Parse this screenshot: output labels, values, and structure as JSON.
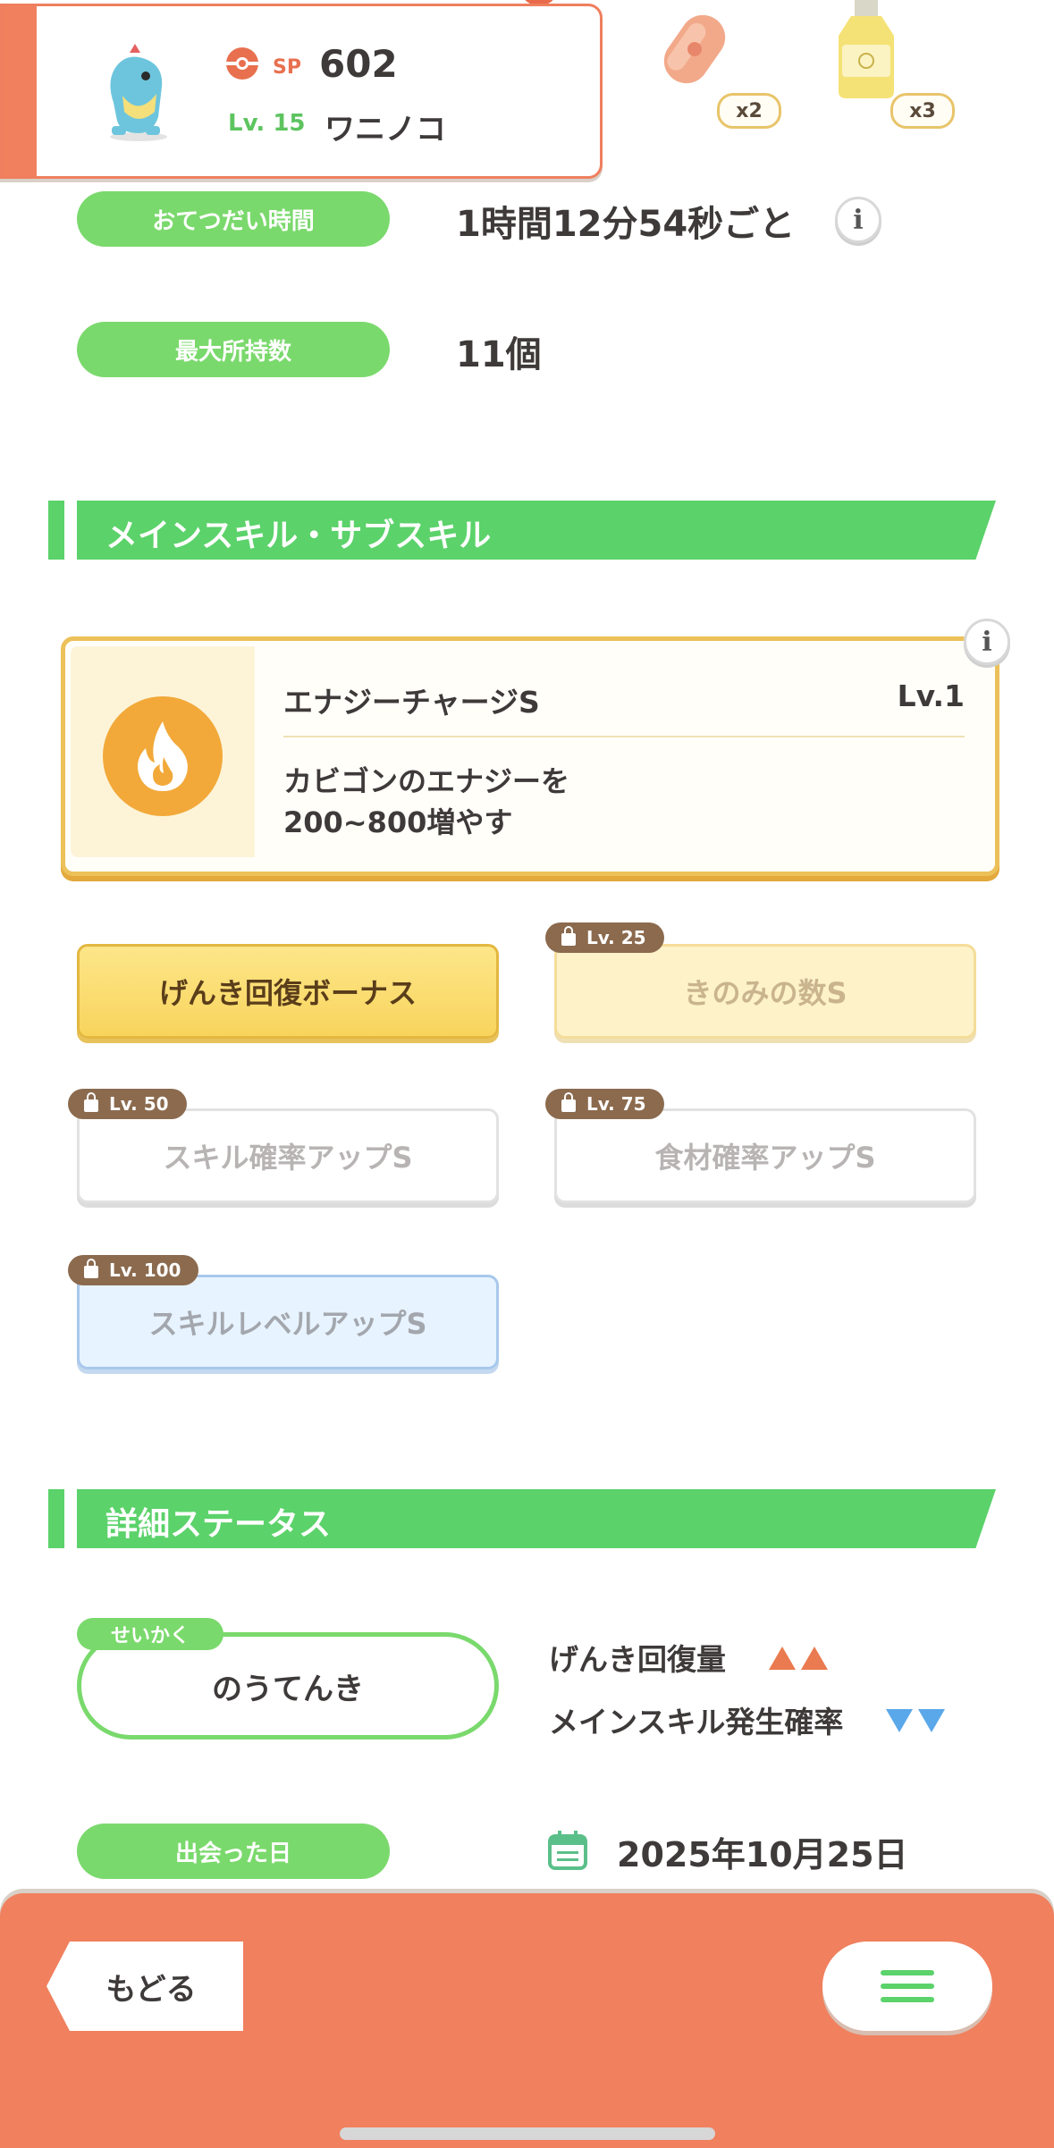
{
  "header": {
    "sp_label": "SP",
    "sp_value": "602",
    "level": "Lv. 15",
    "name": "ワニノコ"
  },
  "ingredients": [
    {
      "name": "sausage",
      "count": "x2"
    },
    {
      "name": "oil-bottle",
      "count": "x3"
    }
  ],
  "info": {
    "help_time_label": "おてつだい時間",
    "help_time_value": "1時間12分54秒ごと",
    "max_carry_label": "最大所持数",
    "max_carry_value": "11個"
  },
  "skills_section": {
    "title": "メインスキル・サブスキル",
    "main_skill": {
      "name": "エナジーチャージS",
      "level": "Lv.1",
      "desc_line1": "カビゴンのエナジーを",
      "desc_line2": "200~800増やす",
      "icon": "flame-icon"
    },
    "sub_skills": [
      {
        "label": "げんき回復ボーナス",
        "lock": ""
      },
      {
        "label": "きのみの数S",
        "lock": "Lv. 25"
      },
      {
        "label": "スキル確率アップS",
        "lock": "Lv. 50"
      },
      {
        "label": "食材確率アップS",
        "lock": "Lv. 75"
      },
      {
        "label": "スキルレベルアップS",
        "lock": "Lv. 100"
      }
    ]
  },
  "detail_section": {
    "title": "詳細ステータス",
    "nature_tag": "せいかく",
    "nature_value": "のうてんき",
    "stat_up": "げんき回復量",
    "stat_down": "メインスキル発生確率",
    "met_label": "出会った日",
    "met_date": "2025年10月25日"
  },
  "footer": {
    "back_label": "もどる"
  },
  "colors": {
    "accent": "#f0805e",
    "green": "#7ad96c",
    "gold": "#ecc15a"
  }
}
